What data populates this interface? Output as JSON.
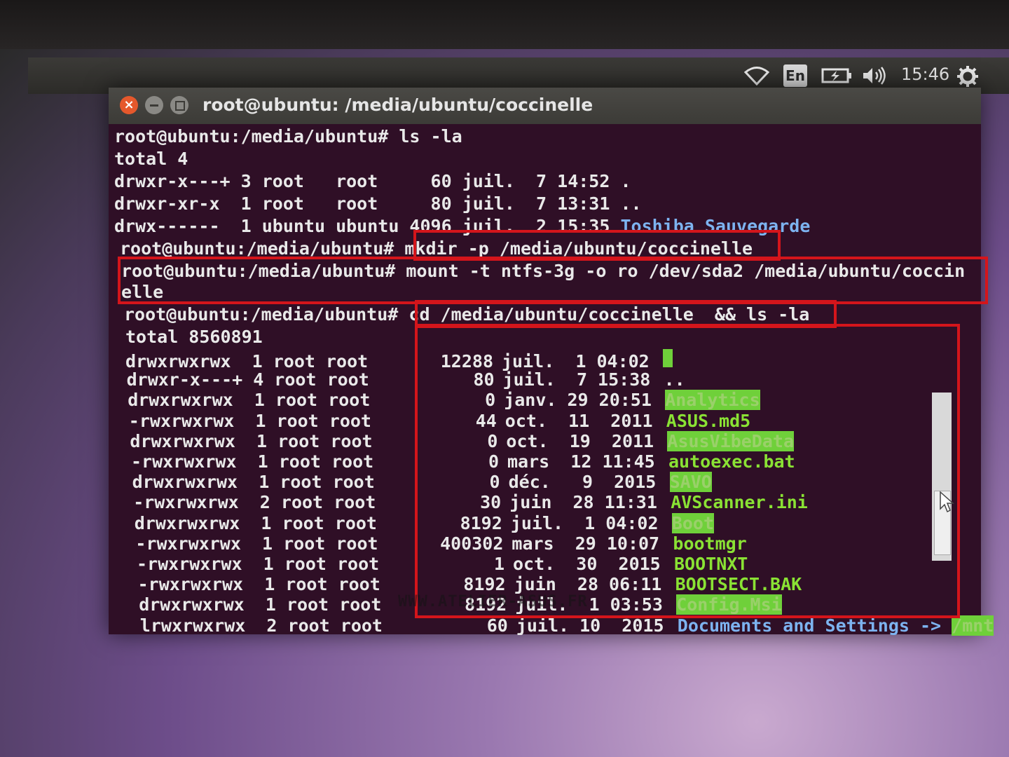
{
  "panel": {
    "language": "En",
    "clock": "15:46",
    "icons": [
      "wifi-icon",
      "battery-icon",
      "volume-icon",
      "gear-icon"
    ]
  },
  "window": {
    "title": "root@ubuntu: /media/ubuntu/coccinelle",
    "close_glyph": "×"
  },
  "terminal": {
    "lines": [
      "root@ubuntu:/media/ubuntu# ls -la",
      "total 4",
      "drwxr-x---+ 3 root   root     60 juil.  7 14:52 .",
      "drwxr-xr-x  1 root   root     80 juil.  7 13:31 ..",
      "drwx------  1 ubuntu ubuntu 4096 juil.  2 15:35 "
    ],
    "toshiba_dir": "Toshiba Sauvegarde",
    "cmd_prompt": "root@ubuntu:/media/ubuntu#",
    "cmd_mkdir": "mkdir -p /media/ubuntu/coccinelle",
    "cmd_mount": "mount -t ntfs-3g -o ro /dev/sda2 /media/ubuntu/coccin",
    "cmd_mount_wrap": "elle",
    "cmd_cd": "cd /media/ubuntu/coccinelle  && ls -la",
    "total2": "total 8560891",
    "listing": [
      {
        "perm": "drwxrwxrwx  1 root root",
        "size": "12288",
        "date": "juil.  1 04:02",
        "name": ""
      },
      {
        "perm": "drwxr-x---+ 4 root root",
        "size": "80",
        "date": "juil.  7 15:38",
        "name": ".."
      },
      {
        "perm": "drwxrwxrwx  1 root root",
        "size": "0",
        "date": "janv. 29 20:51",
        "name": "Analytics"
      },
      {
        "perm": "-rwxrwxrwx  1 root root",
        "size": "44",
        "date": "oct.  11  2011",
        "name": "ASUS.md5"
      },
      {
        "perm": "drwxrwxrwx  1 root root",
        "size": "0",
        "date": "oct.  19  2011",
        "name": "AsusVibeData"
      },
      {
        "perm": "-rwxrwxrwx  1 root root",
        "size": "0",
        "date": "mars  12 11:45",
        "name": "autoexec.bat"
      },
      {
        "perm": "drwxrwxrwx  1 root root",
        "size": "0",
        "date": "déc.   9  2015",
        "name": "SAVO"
      },
      {
        "perm": "-rwxrwxrwx  2 root root",
        "size": "30",
        "date": "juin  28 11:31",
        "name": "AVScanner.ini"
      },
      {
        "perm": "drwxrwxrwx  1 root root",
        "size": "8192",
        "date": "juil.  1 04:02",
        "name": "Boot"
      },
      {
        "perm": "-rwxrwxrwx  1 root root",
        "size": "400302",
        "date": "mars  29 10:07",
        "name": "bootmgr"
      },
      {
        "perm": "-rwxrwxrwx  1 root root",
        "size": "1",
        "date": "oct.  30  2015",
        "name": "BOOTNXT"
      },
      {
        "perm": "-rwxrwxrwx  1 root root",
        "size": "8192",
        "date": "juin  28 06:11",
        "name": "BOOTSECT.BAK"
      },
      {
        "perm": "drwxrwxrwx  1 root root",
        "size": "8192",
        "date": "juil.  1 03:53",
        "name": "Config.Msi"
      },
      {
        "perm": "lrwxrwxrwx  2 root root",
        "size": "60",
        "date": "juil. 10  2015",
        "name": "Documents and Settings -> "
      }
    ],
    "link_target": "/mnt"
  },
  "watermark": "WWW.ATELIER-ASUS.FR",
  "colors": {
    "terminal_bg": "#2f0f26",
    "highlight_green": "#6fd03a",
    "dir_blue": "#7db3f0",
    "annotation_red": "#d4151b",
    "close_orange": "#e5582c"
  }
}
